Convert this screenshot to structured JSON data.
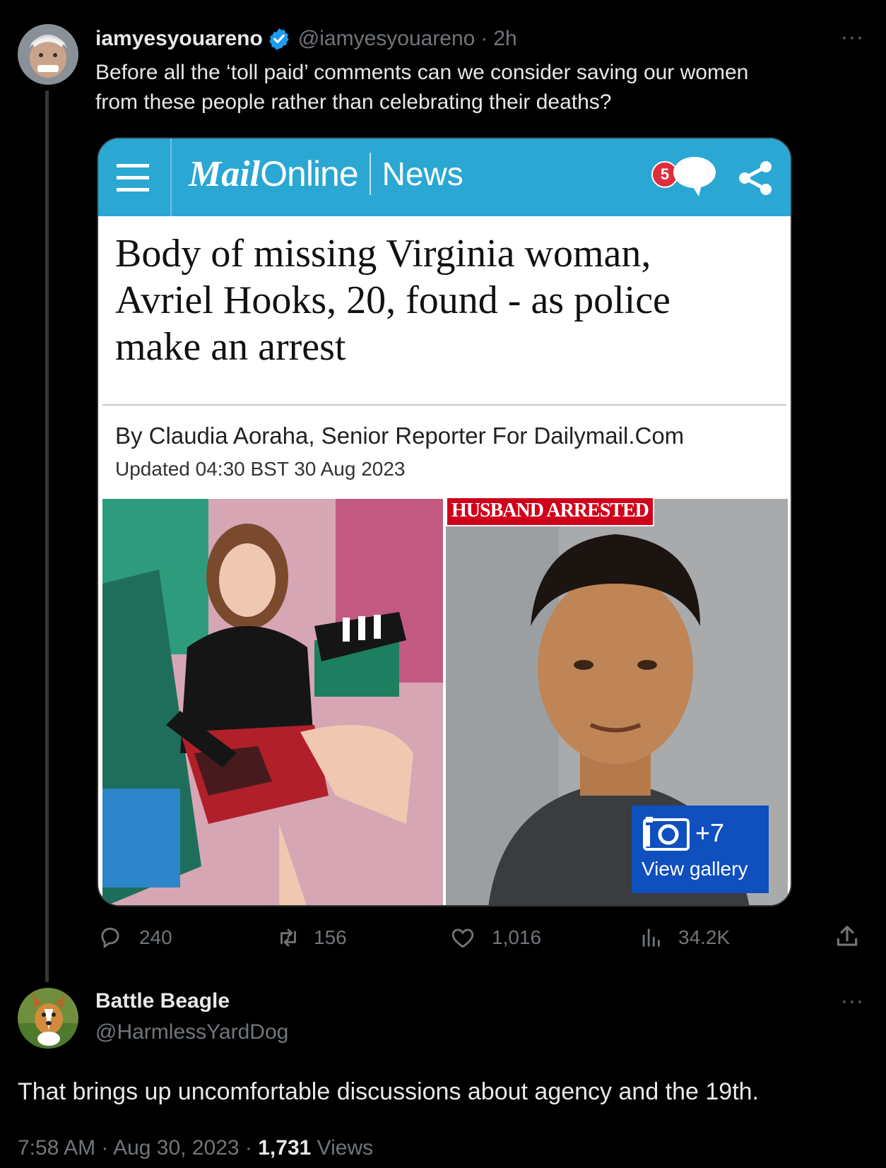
{
  "tweet": {
    "author_name": "iamyesyouareno",
    "author_handle": "@iamyesyouareno",
    "separator": "·",
    "time_ago": "2h",
    "text_line1": "Before all the ‘toll paid’ comments can we consider saving our women",
    "text_line2": "from these people rather than celebrating their deaths?",
    "more": "···",
    "stats": {
      "replies": "240",
      "retweets": "156",
      "likes": "1,016",
      "views": "34.2K"
    }
  },
  "card": {
    "logo_mail": "Mail",
    "logo_online": "Online",
    "section": "News",
    "comment_count": "5",
    "headline_line1": "Body of missing Virginia woman,",
    "headline_line2": "Avriel Hooks, 20, found - as police",
    "headline_line3": "make an arrest",
    "byline": "By Claudia Aoraha, Senior Reporter For Dailymail.Com",
    "updated": "Updated 04:30 BST 30 Aug 2023",
    "overlay_label": "HUSBAND ARRESTED",
    "gallery_count": "+7",
    "gallery_label": "View gallery"
  },
  "reply": {
    "author_name": "Battle Beagle",
    "author_handle": "@HarmlessYardDog",
    "more": "···",
    "text": "That brings up uncomfortable discussions about agency and the 19th.",
    "time": "7:58 AM · Aug 30, 2023 · ",
    "views_count": "1,731",
    "views_label": " Views"
  },
  "colors": {
    "background": "#000000",
    "verified": "#1d9bf0",
    "mail_bar": "#2aa7d3",
    "badge": "#e02d3c",
    "husband_label": "#d0021b",
    "gallery": "#0f4fbe"
  }
}
